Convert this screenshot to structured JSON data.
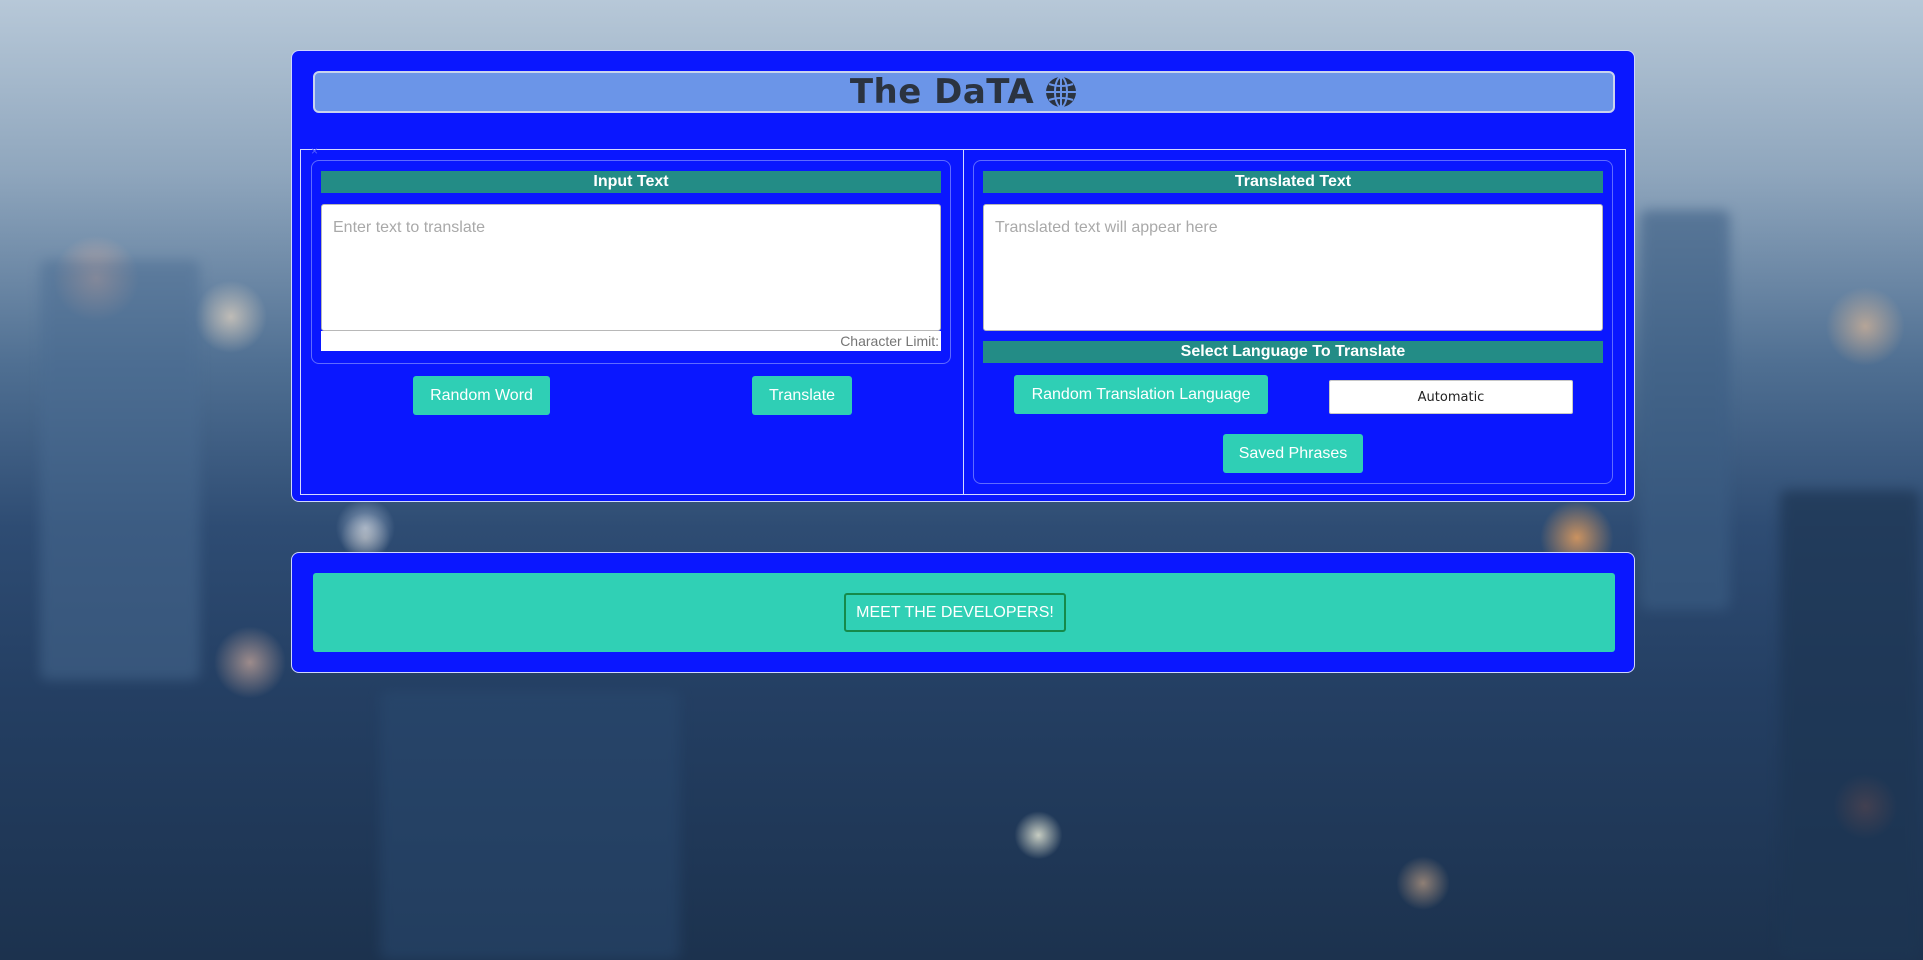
{
  "app": {
    "title": "The DaTA",
    "title_icon": "globe-icon"
  },
  "input_section": {
    "header": "Input Text",
    "placeholder": "Enter text to translate",
    "value": "",
    "char_limit_label": "Character Limit:"
  },
  "output_section": {
    "header": "Translated Text",
    "placeholder": "Translated text will appear here",
    "value": ""
  },
  "language_section": {
    "header": "Select Language To Translate",
    "random_language_label": "Random Translation Language",
    "selected_language": "Automatic"
  },
  "buttons": {
    "random_word": "Random Word",
    "translate": "Translate",
    "saved_phrases": "Saved Phrases",
    "meet_developers": "MEET THE DEVELOPERS!"
  },
  "colors": {
    "panel": "#0a17ff",
    "title_bar": "#6b95e8",
    "header_bar": "#238c86",
    "button": "#2fcfb5",
    "developer_border": "#158a4a"
  }
}
